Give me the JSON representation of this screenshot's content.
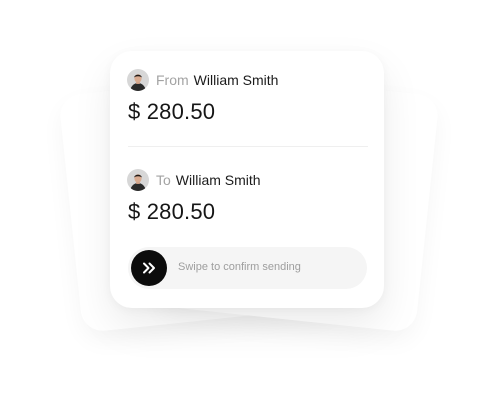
{
  "transfer": {
    "from": {
      "prefix": "From",
      "name": "William Smith",
      "amount": "$ 280.50",
      "avatar": "person-avatar"
    },
    "to": {
      "prefix": "To",
      "name": "William Smith",
      "amount": "$ 280.50",
      "avatar": "person-avatar"
    }
  },
  "swipe": {
    "label": "Swipe to confirm sending",
    "icon": "double-chevron-right-icon"
  },
  "colors": {
    "handle": "#0c0c0c",
    "track": "#f5f5f5",
    "prefix_text": "#a3a3a3"
  }
}
